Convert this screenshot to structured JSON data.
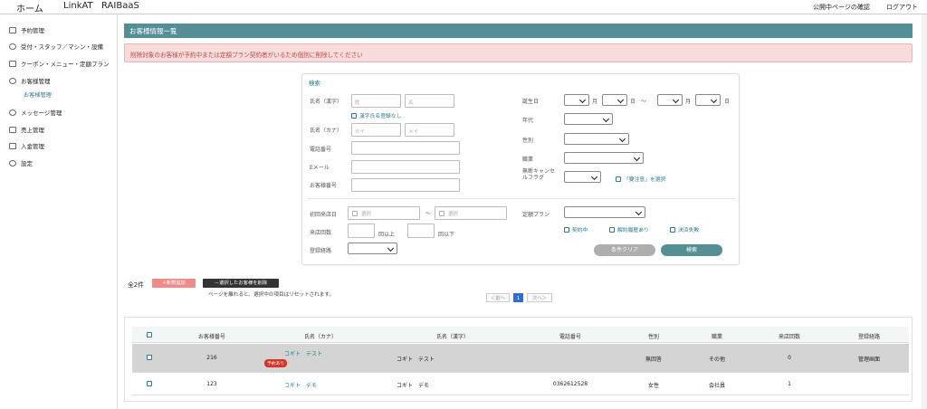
{
  "topbar": {
    "tabs": [
      "ホーム",
      "LinkAT",
      "RAIBaaS"
    ],
    "public_page": "公開中ページの確認",
    "logout": "ログアウト"
  },
  "sidebar": {
    "items": [
      {
        "label": "予約管理",
        "icon": "calendar-icon"
      },
      {
        "label": "受付・スタッフ／マシン・設備",
        "icon": "user-icon"
      },
      {
        "label": "クーポン・メニュー・定額プラン",
        "icon": "coupon-icon"
      },
      {
        "label": "お客様管理",
        "icon": "customers-icon"
      },
      {
        "label": "メッセージ管理",
        "icon": "message-icon"
      },
      {
        "label": "売上管理",
        "icon": "chart-icon"
      },
      {
        "label": "入金管理",
        "icon": "deposit-icon"
      },
      {
        "label": "設定",
        "icon": "gear-icon"
      }
    ],
    "sub_item": "お客様管理"
  },
  "page": {
    "title": "お客様情報一覧",
    "alert": "削除対象のお客様が予約中または定額プラン契約者がいるため個別に削除してください"
  },
  "search": {
    "title": "検索",
    "name_kanji_label": "氏名（漢字）",
    "last_name_ph": "姓",
    "first_name_ph": "名",
    "no_kanji_chk": "漢字氏名登録なし",
    "name_kana_label": "氏名（カナ）",
    "sei_ph": "セイ",
    "mei_ph": "メイ",
    "phone_label": "電話番号",
    "email_label": "Eメール",
    "customer_no_label": "お客様番号",
    "birthday_label": "誕生日",
    "month": "月",
    "day": "日",
    "tilde": "～",
    "age_label": "年代",
    "gender_label": "性別",
    "job_label": "職業",
    "cancel_flag_label": "無断キャンセルフラグ",
    "caution_chk": "「要注意」を選択",
    "first_visit_label": "初回来店日",
    "date_ph": "選択",
    "visits_label": "来店回数",
    "visits_min": "回以上",
    "visits_max": "回以下",
    "route_label": "登録経路",
    "plan_label": "定額プラン",
    "plan_chk_1": "契約中",
    "plan_chk_2": "解約履歴あり",
    "plan_chk_3": "決済失敗",
    "clear_btn": "条件クリア",
    "search_btn": "検索"
  },
  "results": {
    "count": "全2件",
    "new_btn": "+新規追加",
    "delete_btn": "－選択したお客様を削除",
    "note": "ページを離れると、選択中の項目はリセットされます。",
    "prev": "＜前へ",
    "page": "1",
    "next": "次へ＞"
  },
  "table": {
    "headers": [
      "お客様番号",
      "氏名（カナ）",
      "氏名（漢字）",
      "電話番号",
      "性別",
      "職業",
      "来店回数",
      "登録経路"
    ],
    "rows": [
      {
        "no": "216",
        "kana": "コギト　テスト",
        "tag": "予約あり",
        "kanji": "コギト　テスト",
        "phone": "",
        "gender": "無回答",
        "job": "その他",
        "visits": "0",
        "route": "管理画面"
      },
      {
        "no": "123",
        "kana": "コギト　デモ",
        "tag": "",
        "kanji": "コギト　デモ",
        "phone": "0362612528",
        "gender": "女性",
        "job": "会社員",
        "visits": "1",
        "route": ""
      }
    ]
  },
  "colors": {
    "accent": "#558f96",
    "alert_bg": "#f8dcdc",
    "new_btn": "#ef8b8b",
    "tag": "#d9302b"
  }
}
